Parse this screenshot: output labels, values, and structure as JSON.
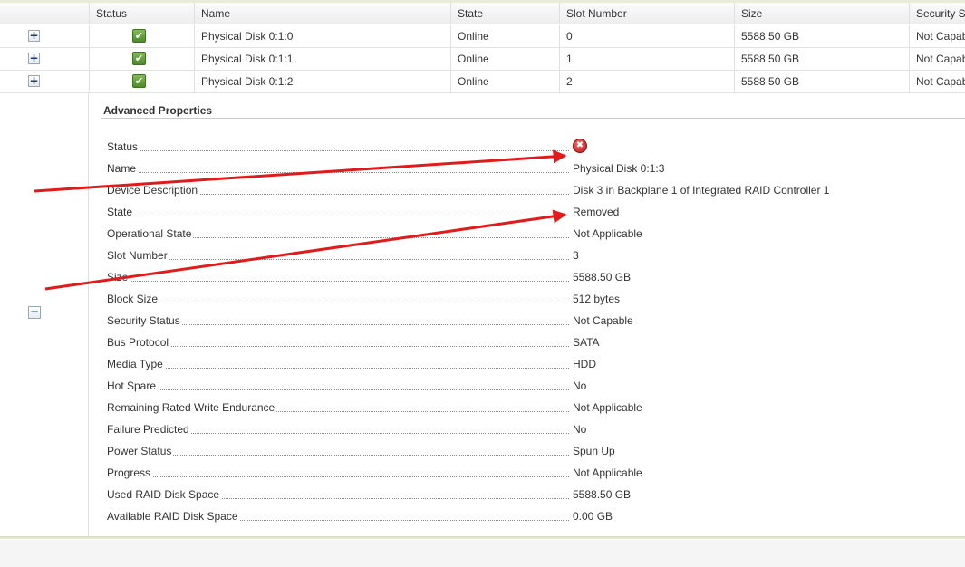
{
  "table": {
    "headers": {
      "status": "Status",
      "name": "Name",
      "state": "State",
      "slot": "Slot Number",
      "size": "Size",
      "security": "Security S"
    },
    "expand_symbol": "+",
    "collapse_symbol": "−",
    "rows": [
      {
        "name": "Physical Disk 0:1:0",
        "state": "Online",
        "slot": "0",
        "size": "5588.50 GB",
        "security": "Not Capab"
      },
      {
        "name": "Physical Disk 0:1:1",
        "state": "Online",
        "slot": "1",
        "size": "5588.50 GB",
        "security": "Not Capab"
      },
      {
        "name": "Physical Disk 0:1:2",
        "state": "Online",
        "slot": "2",
        "size": "5588.50 GB",
        "security": "Not Capab"
      }
    ]
  },
  "advanced": {
    "title": "Advanced Properties",
    "properties": [
      {
        "label": "Status",
        "value": "",
        "icon": "error-icon"
      },
      {
        "label": "Name",
        "value": "Physical Disk 0:1:3"
      },
      {
        "label": "Device Description",
        "value": "Disk 3 in Backplane 1 of Integrated RAID Controller 1"
      },
      {
        "label": "State",
        "value": "Removed"
      },
      {
        "label": "Operational State",
        "value": "Not Applicable"
      },
      {
        "label": "Slot Number",
        "value": "3"
      },
      {
        "label": "Size",
        "value": "5588.50 GB"
      },
      {
        "label": "Block Size",
        "value": "512 bytes"
      },
      {
        "label": "Security Status",
        "value": "Not Capable"
      },
      {
        "label": "Bus Protocol",
        "value": "SATA"
      },
      {
        "label": "Media Type",
        "value": "HDD"
      },
      {
        "label": "Hot Spare",
        "value": "No"
      },
      {
        "label": "Remaining Rated Write Endurance",
        "value": "Not Applicable"
      },
      {
        "label": "Failure Predicted",
        "value": "No"
      },
      {
        "label": "Power Status",
        "value": "Spun Up"
      },
      {
        "label": "Progress",
        "value": "Not Applicable"
      },
      {
        "label": "Used RAID Disk Space",
        "value": "5588.50 GB"
      },
      {
        "label": "Available RAID Disk Space",
        "value": "0.00 GB"
      }
    ]
  },
  "icons": {
    "ok": "status-ok-icon",
    "error": "status-error-icon",
    "ok_glyph": "✔",
    "error_glyph": "✖"
  },
  "colors": {
    "annotation_arrow": "#e01b1b",
    "ok_green": "#5a9a34",
    "error_red": "#c41f1f"
  }
}
